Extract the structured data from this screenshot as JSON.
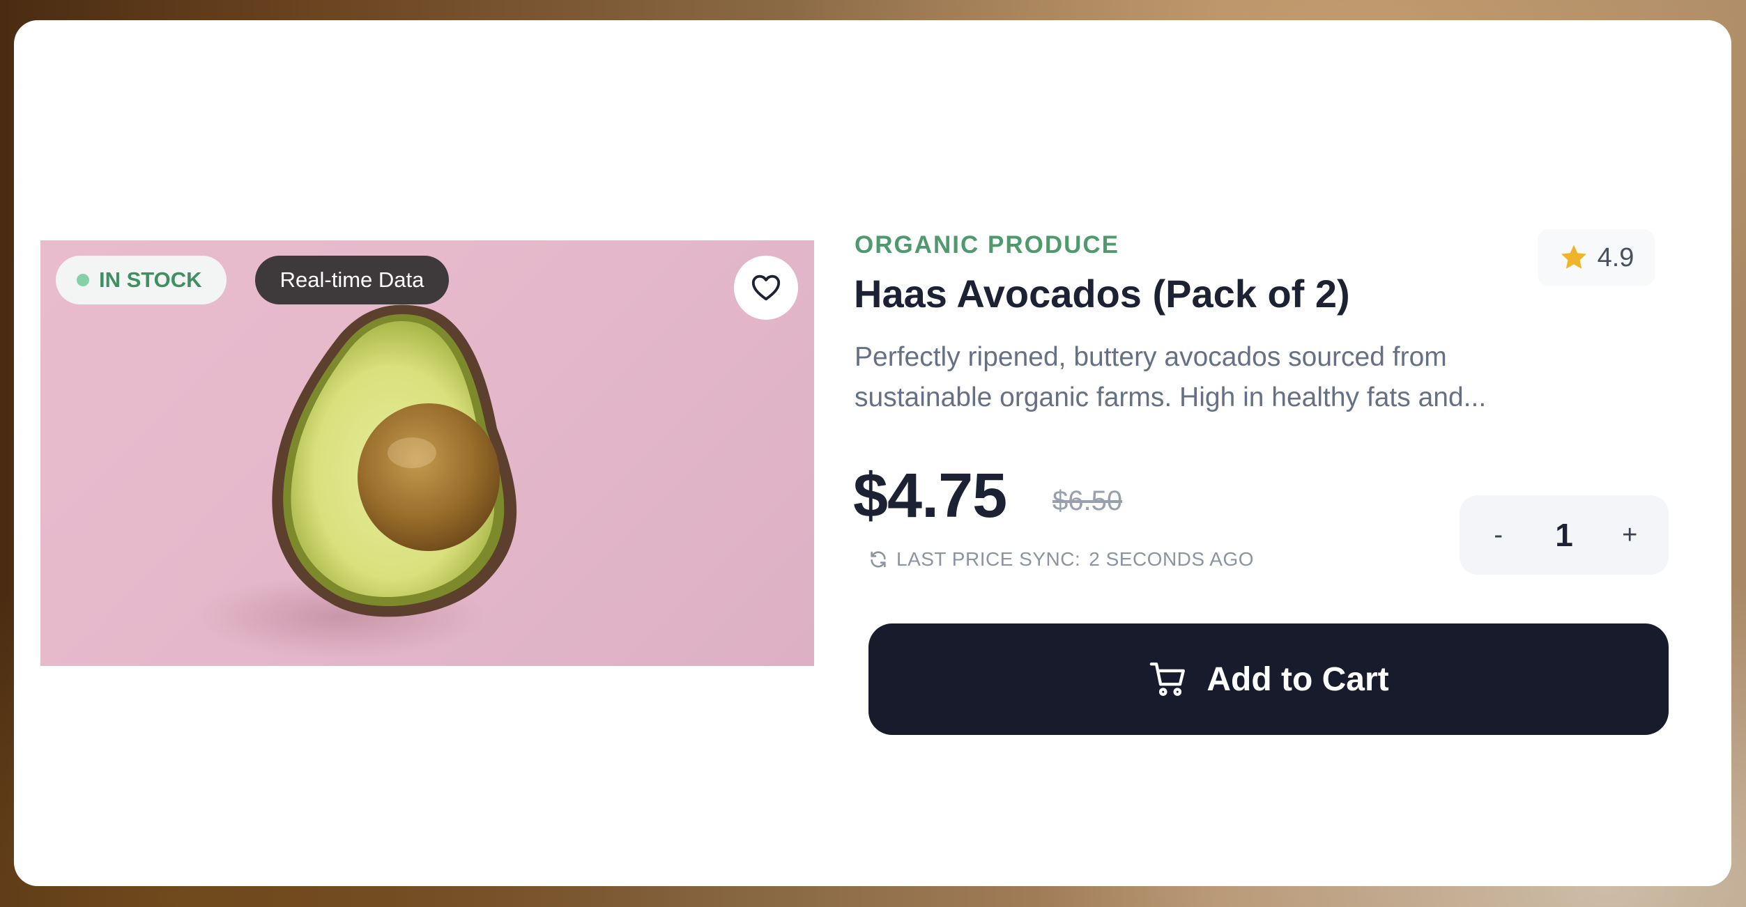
{
  "product": {
    "category": "ORGANIC PRODUCE",
    "title": "Haas Avocados (Pack of 2)",
    "rating": "4.9",
    "description": "Perfectly ripened, buttery avocados sourced from sustainable organic farms. High in healthy fats and...",
    "price": "$4.75",
    "old_price": "$6.50",
    "sync_label": "LAST PRICE SYNC:",
    "sync_value": "2 SECONDS AGO",
    "quantity": "1"
  },
  "badges": {
    "stock": "IN STOCK",
    "realtime": "Real-time Data"
  },
  "controls": {
    "decrement": "-",
    "increment": "+",
    "add_to_cart": "Add to Cart"
  },
  "icons": {
    "favorite": "heart-icon",
    "rating": "star-icon",
    "sync": "refresh-icon",
    "cart": "cart-icon",
    "stock": "status-dot-icon"
  },
  "colors": {
    "accent_green": "#4f9a6c",
    "button_dark": "#171b2c",
    "star": "#f0b429",
    "image_background": "#e6bacc"
  }
}
